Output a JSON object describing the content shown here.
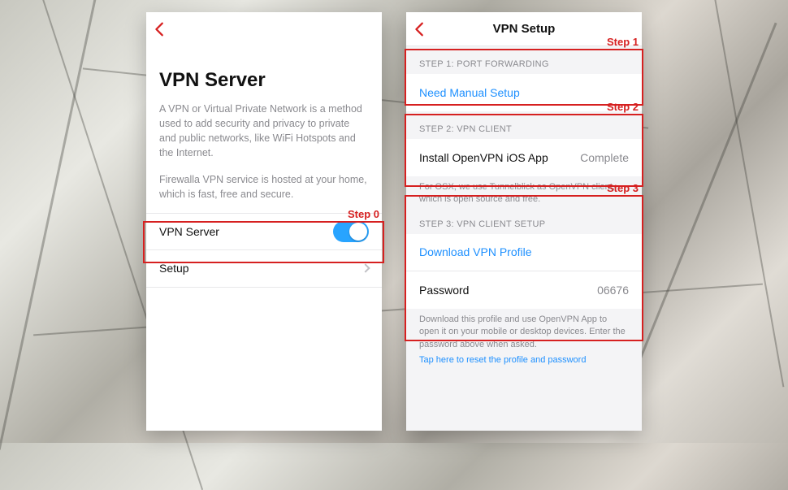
{
  "callouts": {
    "step0": "Step 0",
    "step1": "Step 1",
    "step2": "Step 2",
    "step3": "Step 3"
  },
  "left": {
    "title": "VPN Server",
    "desc1": "A VPN or Virtual Private Network is a method used to add security and privacy to private and public networks, like WiFi Hotspots and the Internet.",
    "desc2": "Firewalla VPN service is hosted at your home, which is fast, free and secure.",
    "row_toggle_label": "VPN Server",
    "row_setup_label": "Setup"
  },
  "right": {
    "nav_title": "VPN Setup",
    "step1_header": "STEP 1: PORT FORWARDING",
    "step1_row": "Need Manual Setup",
    "step2_header": "STEP 2: VPN CLIENT",
    "step2_row_label": "Install OpenVPN iOS App",
    "step2_row_status": "Complete",
    "step2_footer": "For OSX, we use Tunnelblick as OpenVPN client, which is open source and free.",
    "step3_header": "STEP 3: VPN CLIENT SETUP",
    "step3_row1": "Download VPN Profile",
    "step3_row2_label": "Password",
    "step3_row2_value": "06676",
    "step3_footer": "Download this profile and use OpenVPN App to open it on your mobile or desktop devices. Enter the password above when asked.",
    "step3_reset": "Tap here to reset the profile and password"
  }
}
